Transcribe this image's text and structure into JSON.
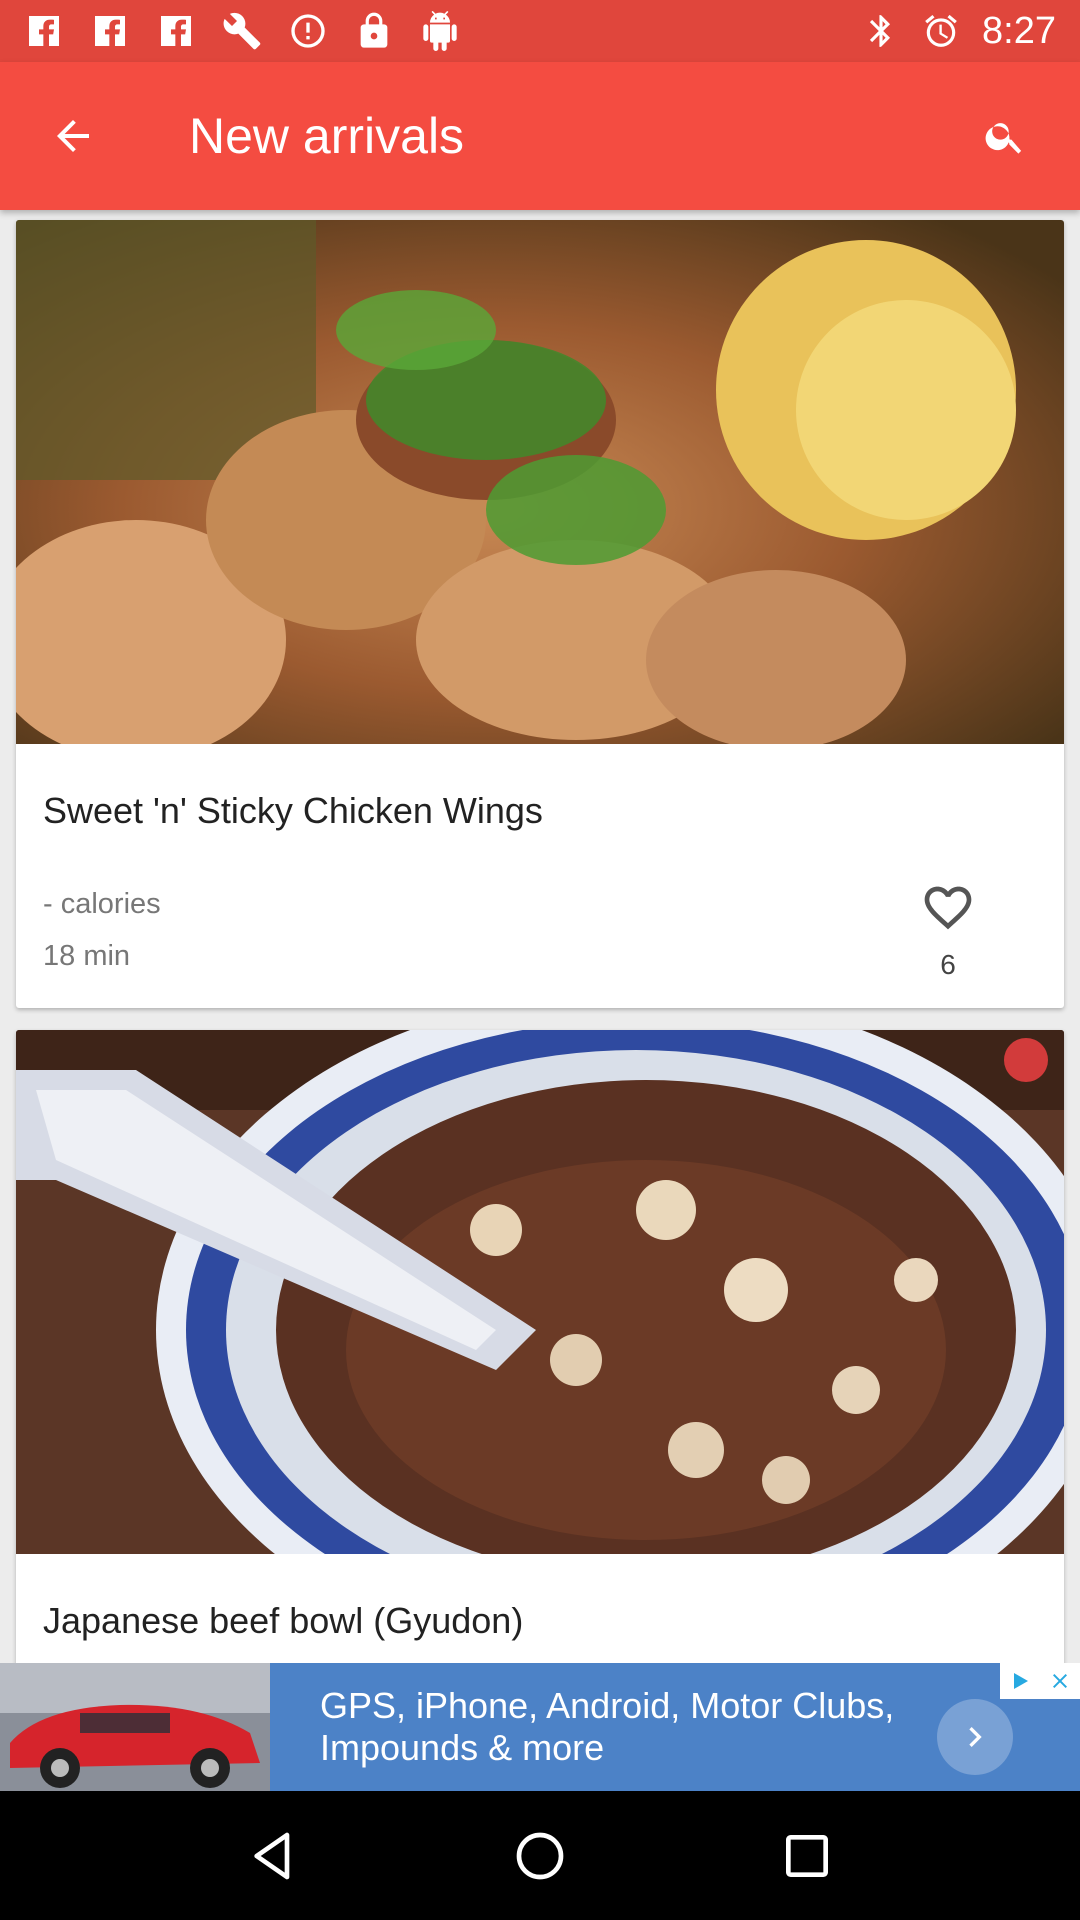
{
  "status_bar": {
    "time": "8:27",
    "left_icons": [
      "facebook-icon",
      "facebook-icon",
      "facebook-icon",
      "wrench-icon",
      "alert-icon",
      "lock-icon",
      "android-icon"
    ],
    "right_icons": [
      "bluetooth-icon",
      "alarm-icon",
      "signal-icon"
    ]
  },
  "app_bar": {
    "title": "New arrivals",
    "back_icon": "arrow-back-icon",
    "search_icon": "search-icon",
    "color": "#f44c41"
  },
  "recipes": [
    {
      "title": "Sweet 'n' Sticky Chicken Wings",
      "calories": "- calories",
      "time": "18 min",
      "likes": "6"
    },
    {
      "title": "Japanese beef bowl (Gyudon)"
    }
  ],
  "ad": {
    "text": "GPS, iPhone, Android, Motor Clubs, Impounds & more"
  },
  "nav_bar": {
    "icons": [
      "back-triangle-icon",
      "home-circle-icon",
      "recents-square-icon"
    ]
  }
}
